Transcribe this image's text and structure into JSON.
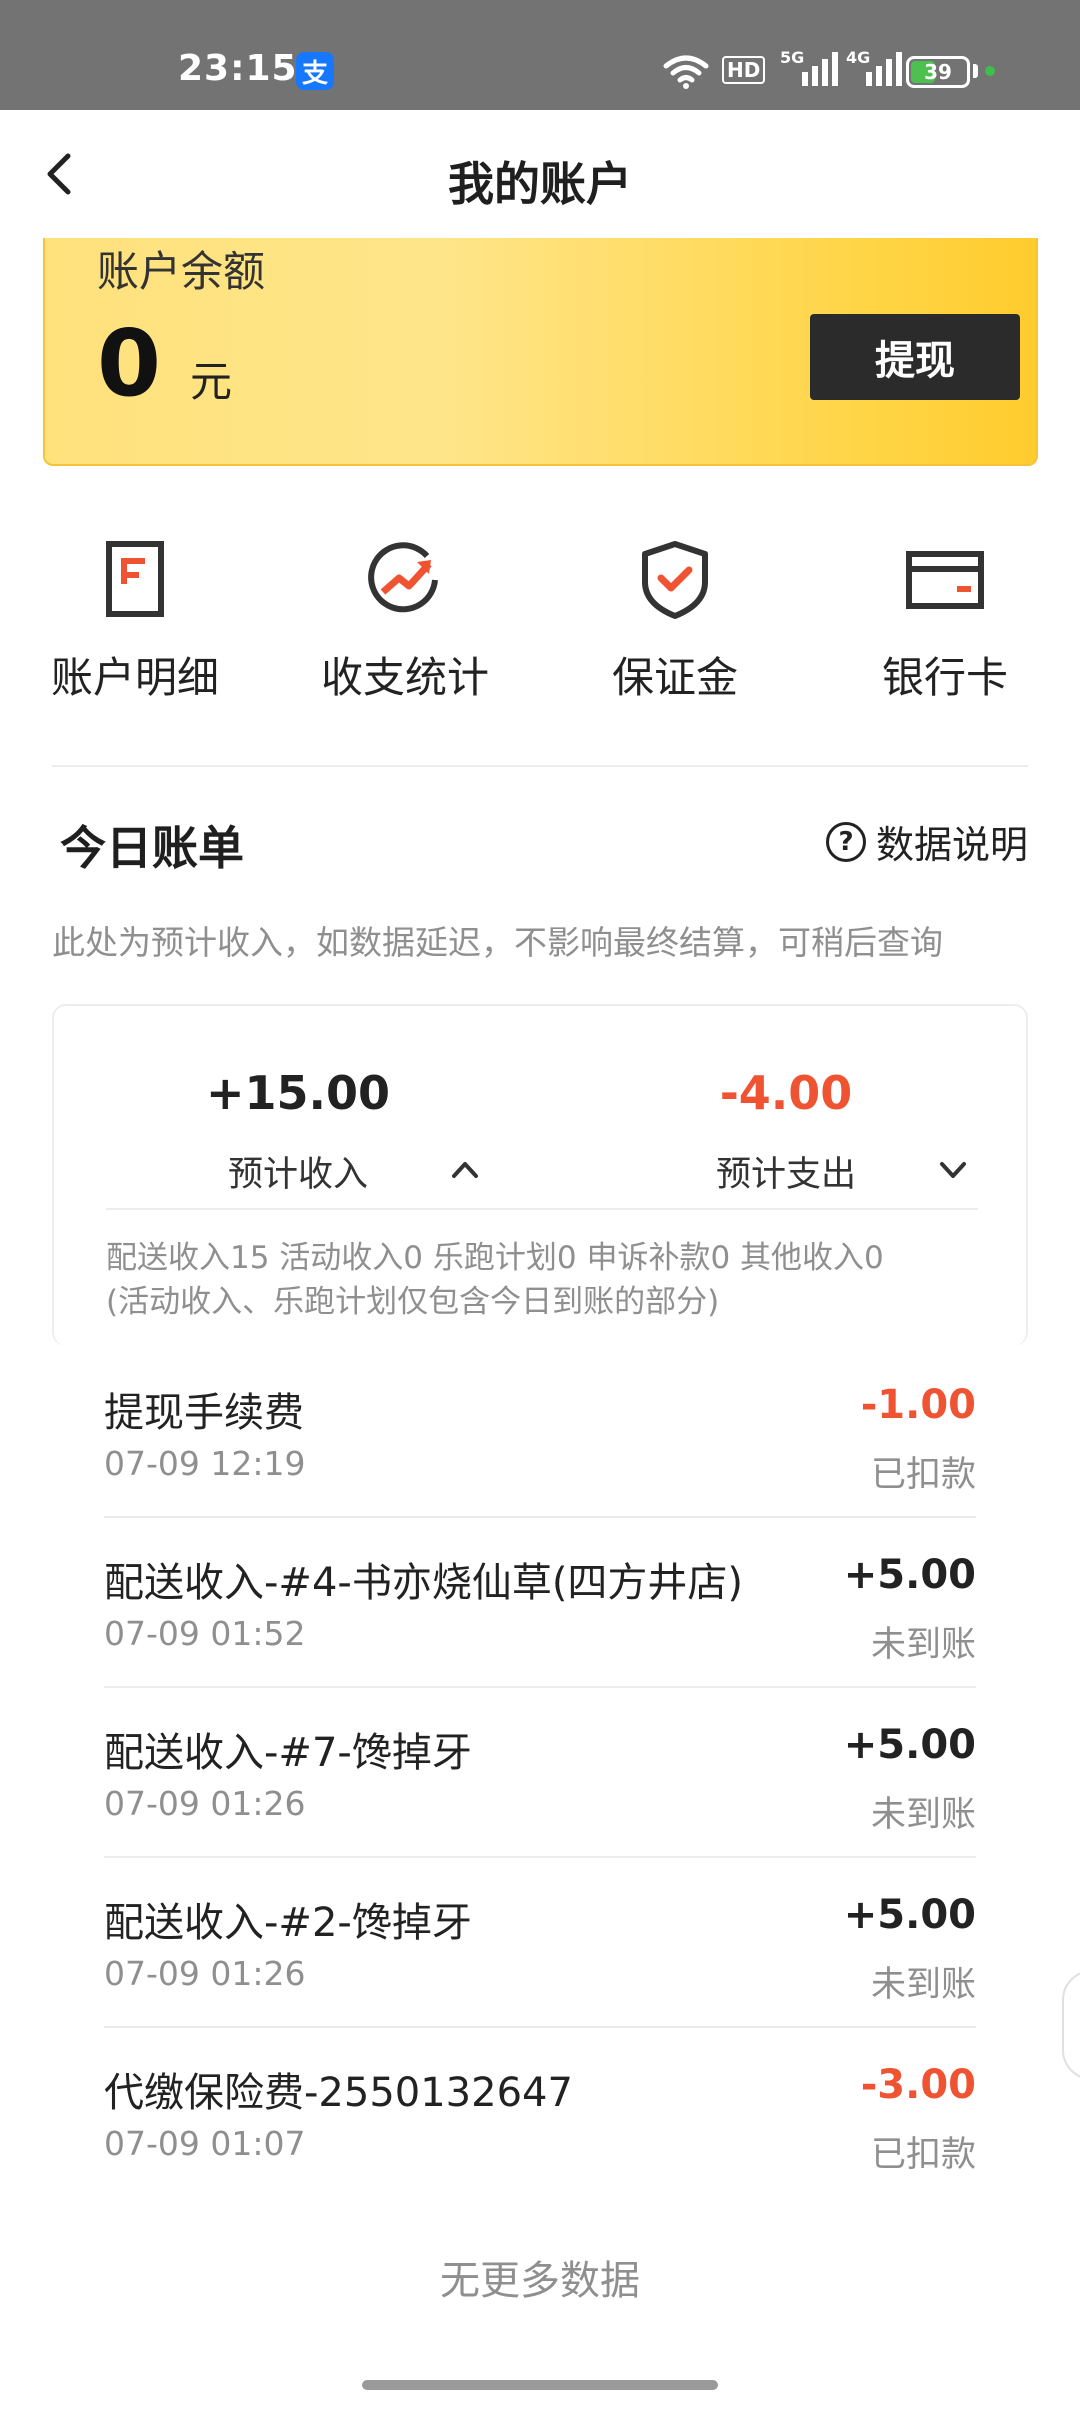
{
  "status_bar": {
    "time": "23:15",
    "alipay_glyph": "支",
    "hd_label": "HD",
    "sig1_label": "5G",
    "sig2_label": "4G",
    "battery": "39"
  },
  "header": {
    "title": "我的账户"
  },
  "balance": {
    "label": "账户余额",
    "amount": "0",
    "unit": "元",
    "withdraw_label": "提现"
  },
  "actions": [
    {
      "label": "账户明细",
      "icon": "account-detail-icon"
    },
    {
      "label": "收支统计",
      "icon": "stats-trend-icon"
    },
    {
      "label": "保证金",
      "icon": "shield-check-icon"
    },
    {
      "label": "银行卡",
      "icon": "bank-card-icon"
    }
  ],
  "bill": {
    "title": "今日账单",
    "explain_label": "数据说明",
    "note": "此处为预计收入，如数据延迟，不影响最终结算，可稍后查询",
    "income_value": "+15.00",
    "income_label": "预计收入",
    "expense_value": "-4.00",
    "expense_label": "预计支出",
    "detail_line1": "配送收入15 活动收入0 乐跑计划0 申诉补款0 其他收入0",
    "detail_line2": "(活动收入、乐跑计划仅包含今日到账的部分)"
  },
  "items": [
    {
      "name": "提现手续费",
      "time": "07-09 12:19",
      "amount": "-1.00",
      "status": "已扣款"
    },
    {
      "name": "配送收入-#4-书亦烧仙草(四方井店)",
      "time": "07-09 01:52",
      "amount": "+5.00",
      "status": "未到账"
    },
    {
      "name": "配送收入-#7-馋掉牙",
      "time": "07-09 01:26",
      "amount": "+5.00",
      "status": "未到账"
    },
    {
      "name": "配送收入-#2-馋掉牙",
      "time": "07-09 01:26",
      "amount": "+5.00",
      "status": "未到账"
    },
    {
      "name": "代缴保险费-2550132647",
      "time": "07-09 01:07",
      "amount": "-3.00",
      "status": "已扣款"
    }
  ],
  "footer": {
    "no_more": "无更多数据"
  },
  "colors": {
    "accent_yellow": "#ffd64a",
    "negative": "#ef5332",
    "muted": "#8f8f8f",
    "dark_button": "#2b2b2b"
  }
}
